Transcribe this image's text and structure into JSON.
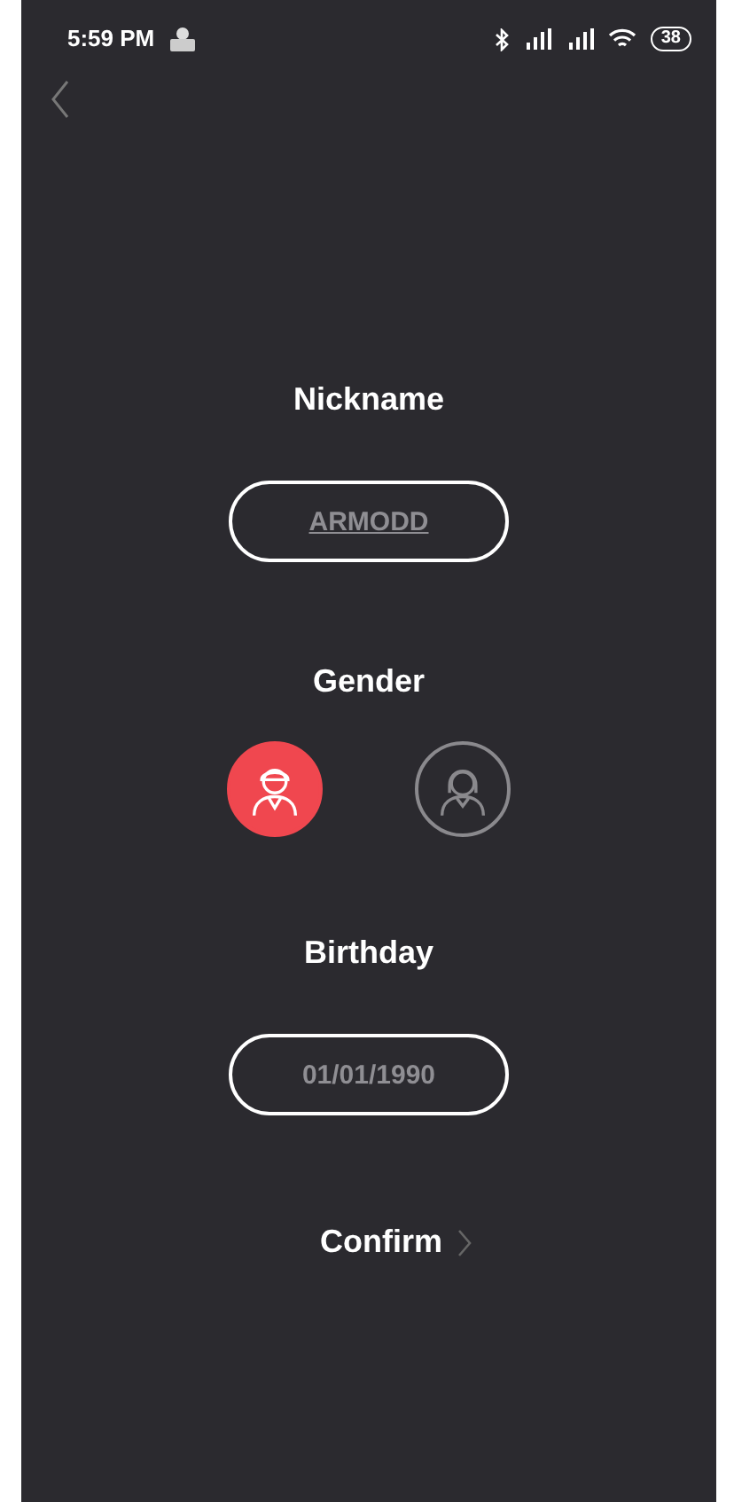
{
  "status_bar": {
    "time": "5:59 PM",
    "battery": "38"
  },
  "nickname": {
    "label": "Nickname",
    "value": "ARMODD"
  },
  "gender": {
    "label": "Gender",
    "options": [
      {
        "kind": "male",
        "selected": true
      },
      {
        "kind": "female",
        "selected": false
      }
    ]
  },
  "birthday": {
    "label": "Birthday",
    "value": "01/01/1990"
  },
  "confirm": {
    "label": "Confirm"
  }
}
